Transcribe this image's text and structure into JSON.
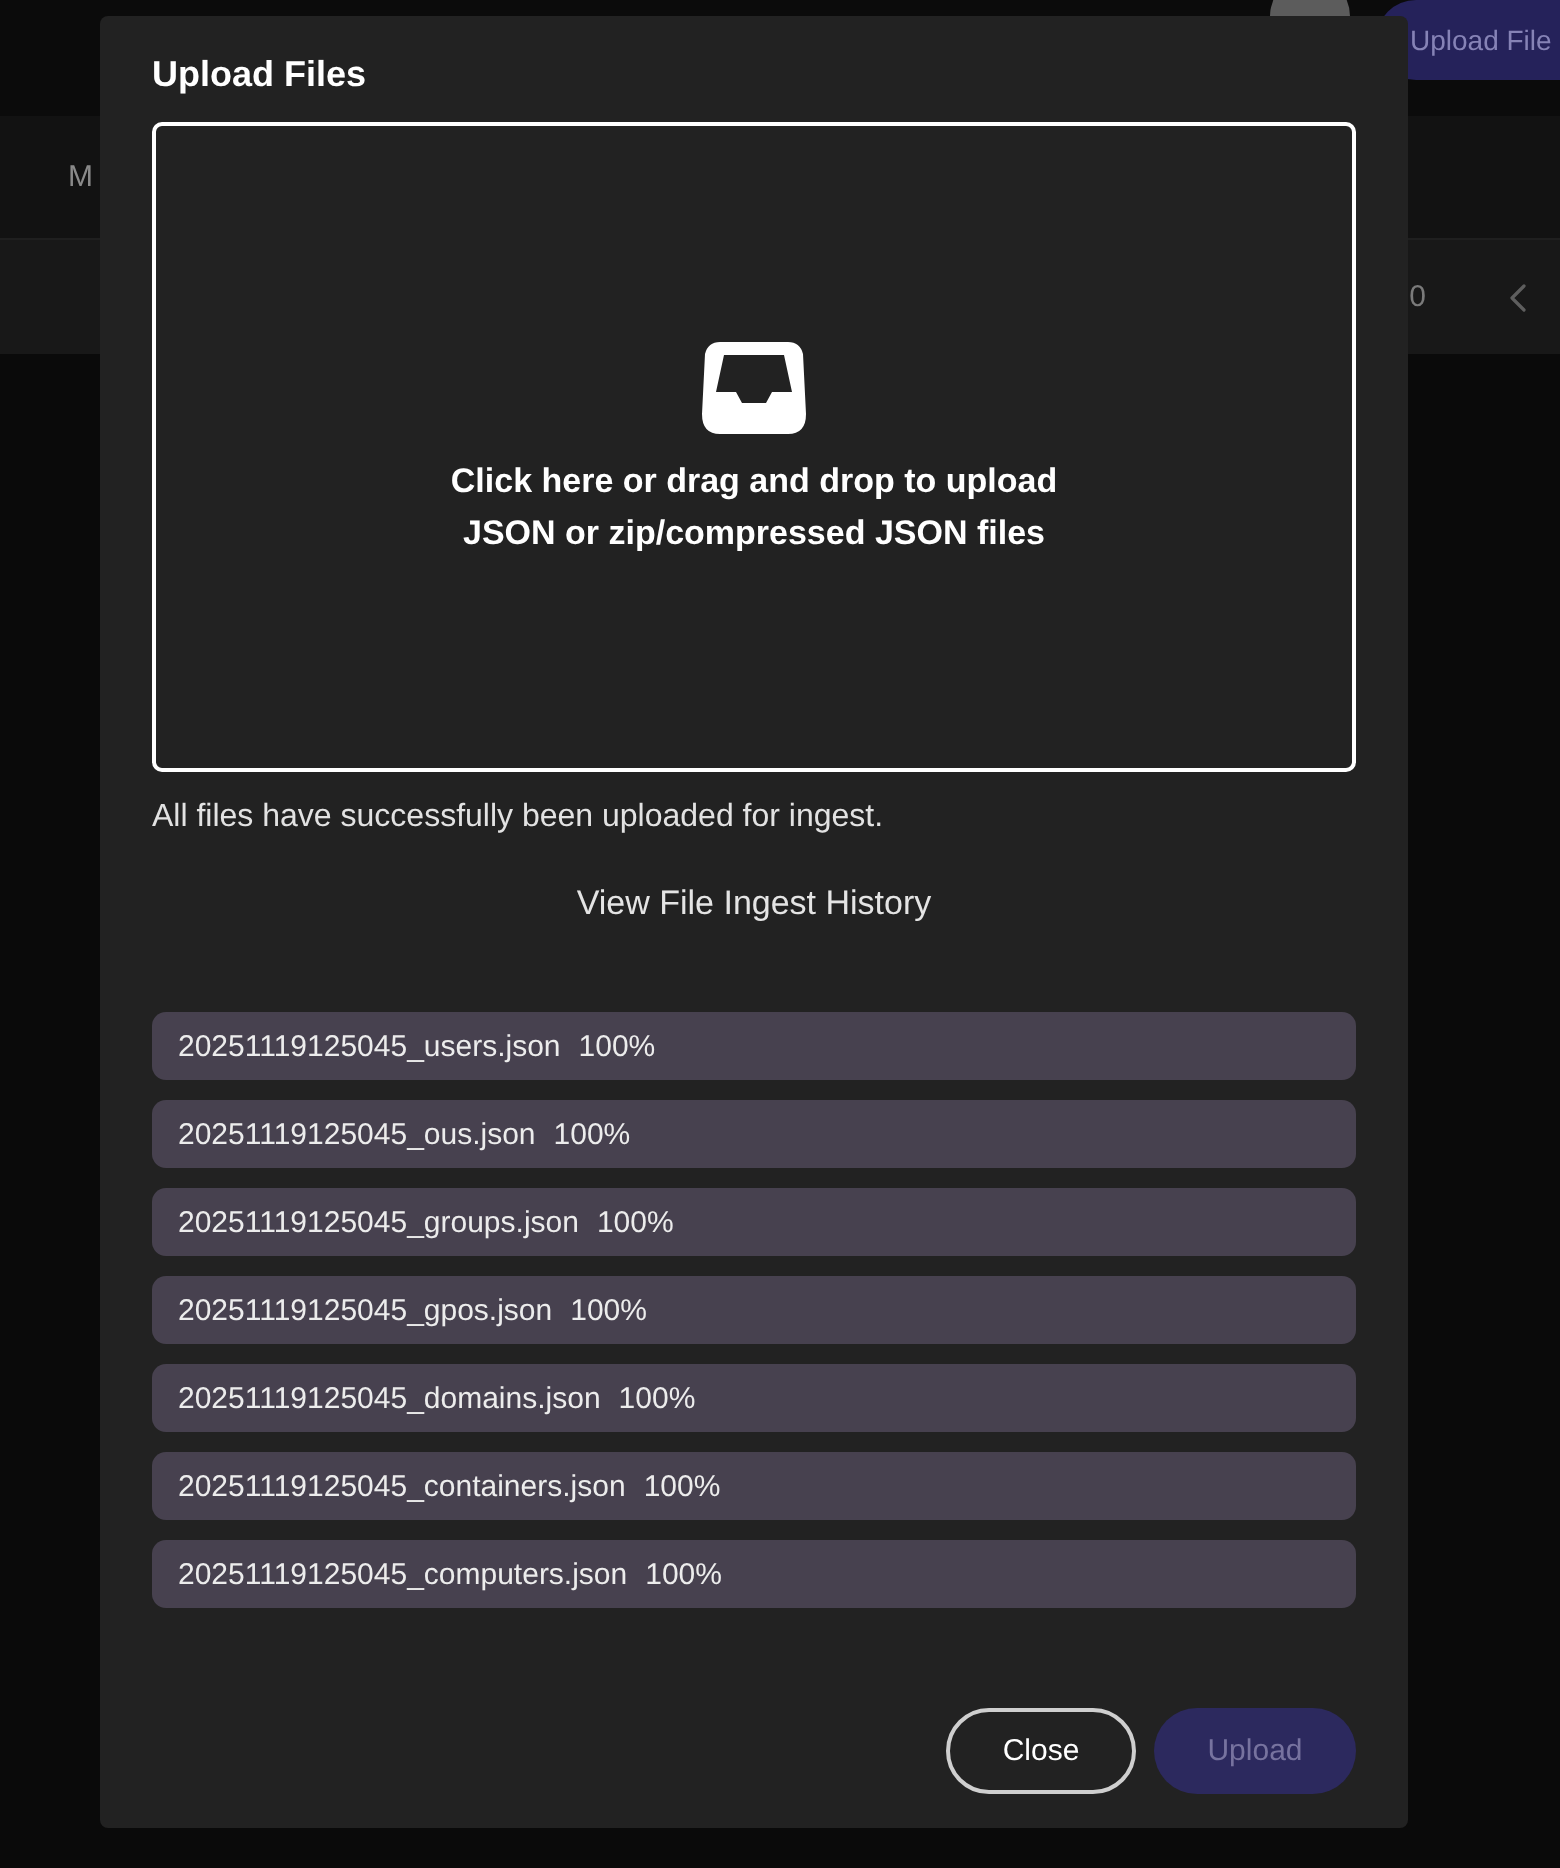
{
  "background": {
    "header_button": "Upload File",
    "nav_text": "M",
    "toolbar_text": "0"
  },
  "dialog": {
    "title": "Upload Files",
    "dropzone": {
      "lines": [
        "Click here or drag and drop to upload",
        "JSON or zip/compressed JSON files"
      ]
    },
    "status_message": "All files have successfully been uploaded for ingest.",
    "history_link": "View File Ingest History",
    "files": [
      {
        "name": "20251119125045_users.json",
        "progress": "100%"
      },
      {
        "name": "20251119125045_ous.json",
        "progress": "100%"
      },
      {
        "name": "20251119125045_groups.json",
        "progress": "100%"
      },
      {
        "name": "20251119125045_gpos.json",
        "progress": "100%"
      },
      {
        "name": "20251119125045_domains.json",
        "progress": "100%"
      },
      {
        "name": "20251119125045_containers.json",
        "progress": "100%"
      },
      {
        "name": "20251119125045_computers.json",
        "progress": "100%"
      }
    ],
    "buttons": [
      {
        "label": "Close",
        "kind": "outlined",
        "disabled": false
      },
      {
        "label": "Upload",
        "kind": "filled",
        "disabled": true
      }
    ]
  }
}
